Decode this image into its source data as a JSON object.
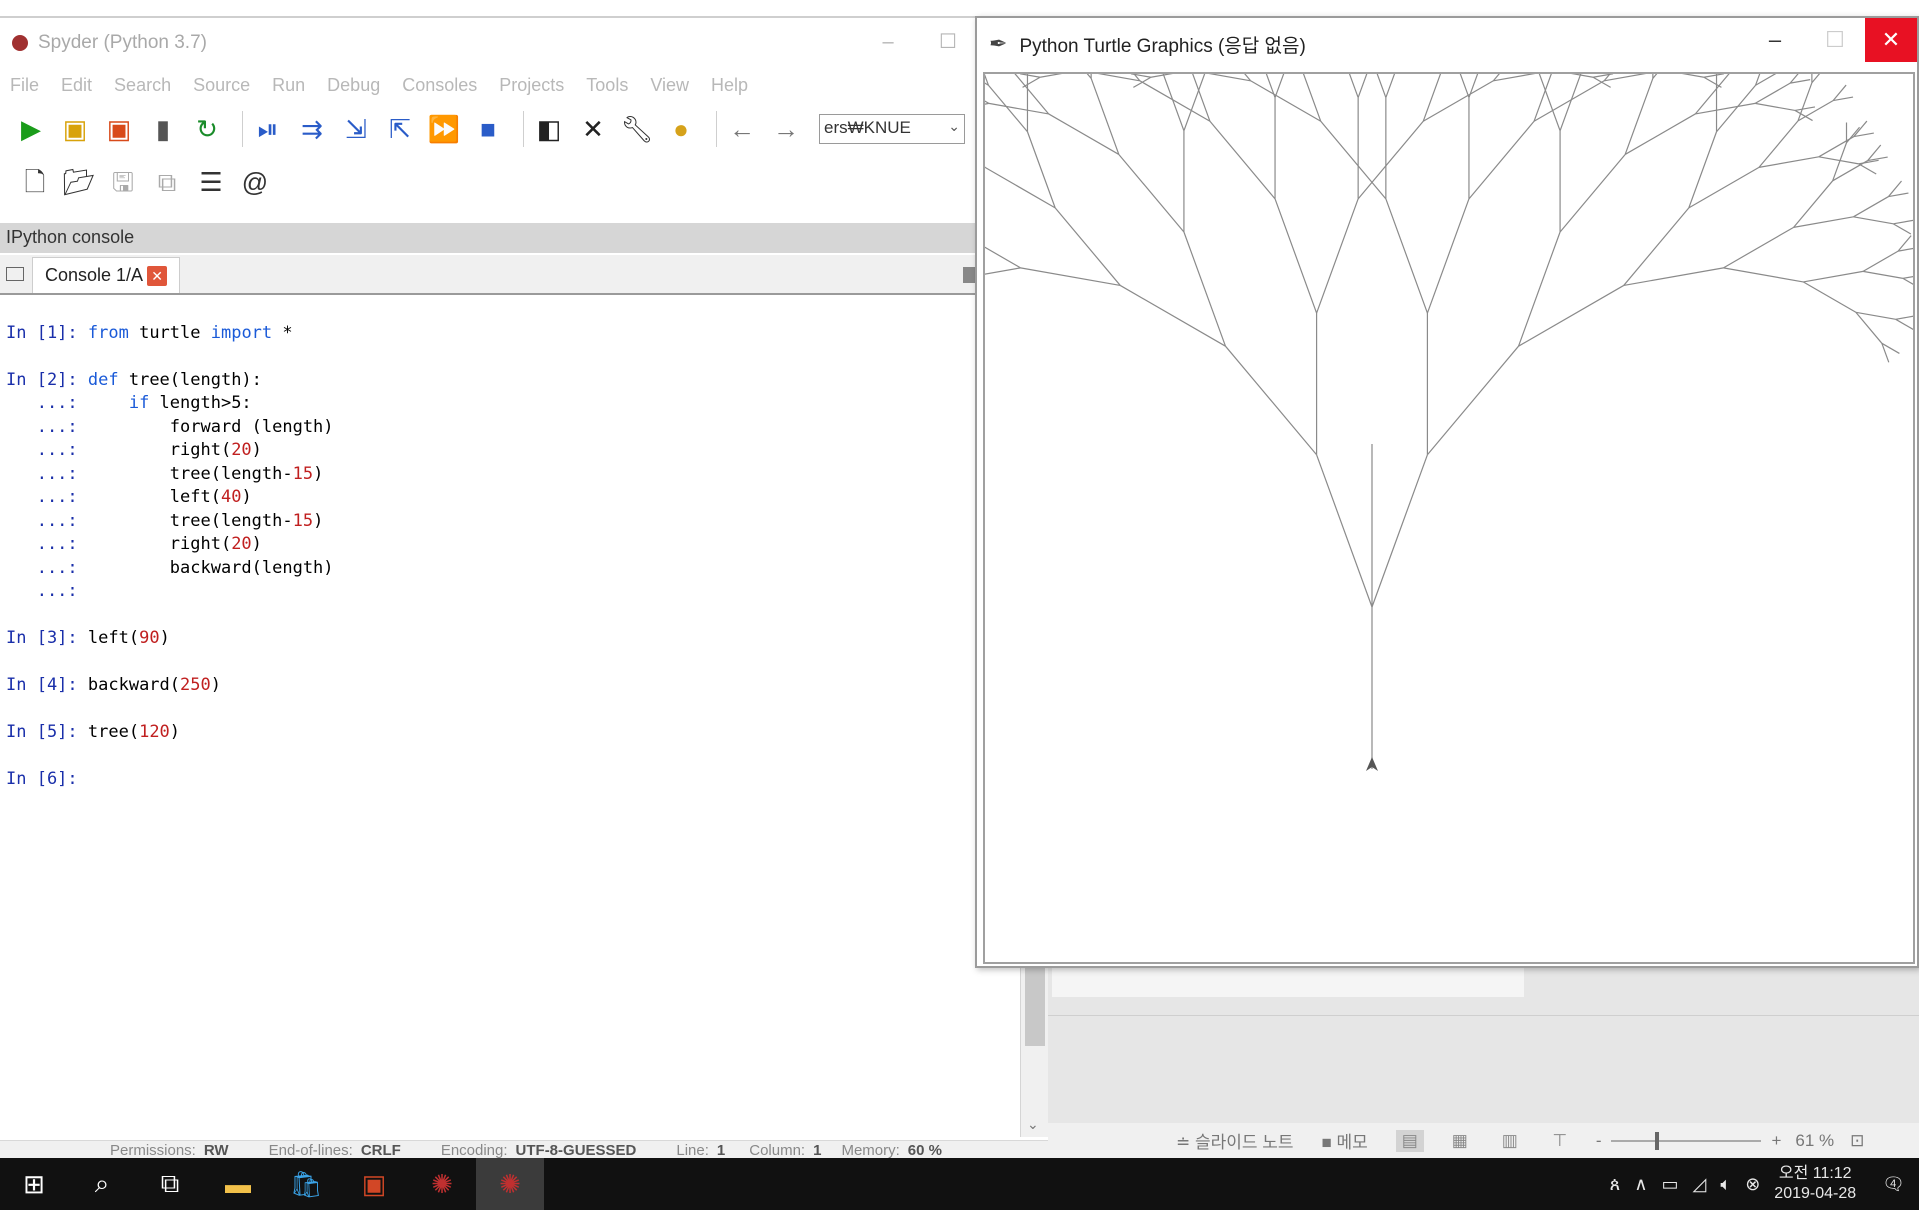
{
  "spyder": {
    "title": "Spyder (Python 3.7)",
    "menu": [
      "File",
      "Edit",
      "Search",
      "Source",
      "Run",
      "Debug",
      "Consoles",
      "Projects",
      "Tools",
      "View",
      "Help"
    ],
    "path_value": "ers₩KNUE",
    "pane_title": "IPython console",
    "tab_label": "Console 1/A",
    "console": {
      "l1_prompt": "In [1]: ",
      "l1_kw1": "from",
      "l1_mid": " turtle ",
      "l1_kw2": "import",
      "l1_end": " *",
      "l2_prompt": "In [2]: ",
      "l2_kw": "def",
      "l2_rest": " tree(length):",
      "l3_cont": "   ...: ",
      "l3_kw": "    if",
      "l3_rest": " length>5:",
      "l4_cont": "   ...: ",
      "l4_code": "        forward (length)",
      "l5_cont": "   ...: ",
      "l5_code": "        right(",
      "l5_num": "20",
      "l5_end": ")",
      "l6_cont": "   ...: ",
      "l6_code": "        tree(length-",
      "l6_num": "15",
      "l6_end": ")",
      "l7_cont": "   ...: ",
      "l7_code": "        left(",
      "l7_num": "40",
      "l7_end": ")",
      "l8_cont": "   ...: ",
      "l8_code": "        tree(length-",
      "l8_num": "15",
      "l8_end": ")",
      "l9_cont": "   ...: ",
      "l9_code": "        right(",
      "l9_num": "20",
      "l9_end": ")",
      "l10_cont": "   ...: ",
      "l10_code": "        backward(length)",
      "l11_cont": "   ...: ",
      "l12_prompt": "In [3]: ",
      "l12_code": "left(",
      "l12_num": "90",
      "l12_end": ")",
      "l13_prompt": "In [4]: ",
      "l13_code": "backward(",
      "l13_num": "250",
      "l13_end": ")",
      "l14_prompt": "In [5]: ",
      "l14_code": "tree(",
      "l14_num": "120",
      "l14_end": ")",
      "l15_prompt": "In [6]: "
    },
    "status": {
      "permissions_label": "Permissions:",
      "permissions_value": "RW",
      "eol_label": "End-of-lines:",
      "eol_value": "CRLF",
      "encoding_label": "Encoding:",
      "encoding_value": "UTF-8-GUESSED",
      "line_label": "Line:",
      "line_value": "1",
      "column_label": "Column:",
      "column_value": "1",
      "memory_label": "Memory:",
      "memory_value": "60 %"
    }
  },
  "turtle": {
    "title": "Python Turtle Graphics (응답 없음)",
    "tree_depth": 8
  },
  "powerpoint": {
    "notes_label": "≐ 슬라이드 노트",
    "comments_label": "■ 메모",
    "zoom_minus": "-",
    "zoom_plus": "+",
    "zoom_value": "61 %"
  },
  "taskbar": {
    "clock_time": "오전 11:12",
    "clock_date": "2019-04-28",
    "notification_count": "4"
  },
  "colors": {
    "close_red": "#e81123",
    "prompt_blue": "#1a2faa",
    "keyword_blue": "#1a5ad8",
    "number_red": "#c01f1f",
    "tree_line": "#8a8a8a"
  }
}
